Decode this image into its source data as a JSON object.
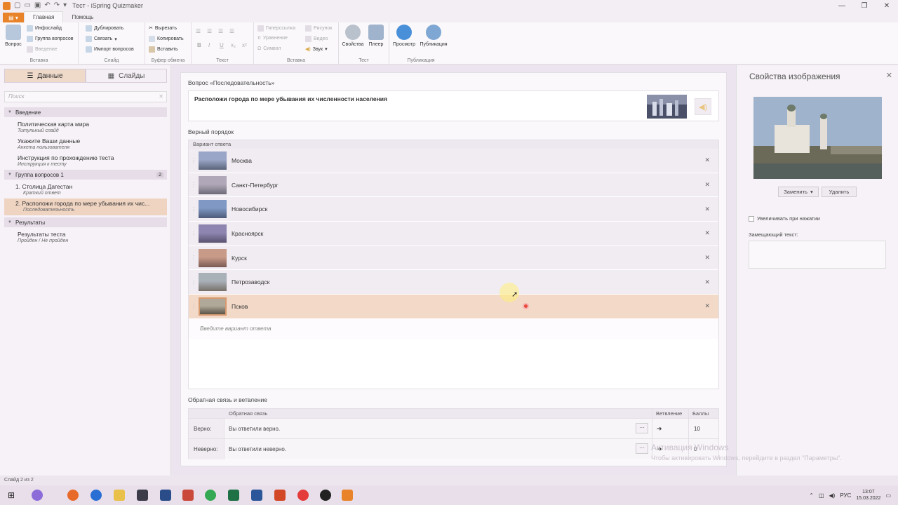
{
  "window": {
    "title": "Тест - iSpring Quizmaker"
  },
  "tabs": [
    "Главная",
    "Помощь"
  ],
  "ribbon": {
    "vopros": "Вопрос",
    "infoslide": "Инфослайд",
    "group_q": "Группа вопросов",
    "vvedenie": "Введение",
    "insert_label": "Вставка",
    "duplicate": "Дублировать",
    "link": "Связать",
    "import_q": "Импорт вопросов",
    "slide_label": "Слайд",
    "cut": "Вырезать",
    "copy": "Копировать",
    "paste": "Вставить",
    "clipboard_label": "Буфер обмена",
    "text_label": "Текст",
    "hyperlink": "Гиперссылка",
    "equation": "Уравнение",
    "symbol": "Символ",
    "picture": "Рисунок",
    "video": "Видео",
    "sound": "Звук",
    "insert2_label": "Вставка",
    "properties": "Свойства",
    "player": "Плеер",
    "test_label": "Тест",
    "preview": "Просмотр",
    "publish": "Публикация",
    "publish_label": "Публикация"
  },
  "left": {
    "tab_data": "Данные",
    "tab_slides": "Слайды",
    "search_placeholder": "Поиск",
    "sec_intro": "Введение",
    "i1_title": "Политическая карта мира",
    "i1_sub": "Титульный слайд",
    "i2_title": "Укажите Ваши данные",
    "i2_sub": "Анкета пользователя",
    "i3_title": "Инструкция по прохождению теста",
    "i3_sub": "Инструкция к тесту",
    "sec_group": "Группа вопросов 1",
    "sec_group_count": "2",
    "q1_title": "1.  Столица Дагестан",
    "q1_sub": "Краткий ответ",
    "q2_title": "2.  Расположи города по мере убывания их чис...",
    "q2_sub": "Последовательность",
    "sec_results": "Результаты",
    "r1_title": "Результаты теста",
    "r1_sub": "Пройден / Не пройден"
  },
  "main": {
    "question_label": "Вопрос «Последовательность»",
    "question_text": "Расположи города по мере убывания их численности населения",
    "order_label": "Верный порядок",
    "answer_col": "Вариант ответа",
    "answers": [
      "Москва",
      "Санкт-Петербург",
      "Новосибирск",
      "Красноярск",
      "Курск",
      "Петрозаводск",
      "Псков"
    ],
    "add_placeholder": "Введите вариант ответа",
    "feedback_label": "Обратная связь и ветвление",
    "fb_col": "Обратная связь",
    "branch_col": "Ветвление",
    "points_col": "Баллы",
    "fb_correct_label": "Верно:",
    "fb_correct_text": "Вы ответили верно.",
    "fb_correct_points": "10",
    "fb_wrong_label": "Неверно:",
    "fb_wrong_text": "Вы ответили неверно.",
    "fb_wrong_points": "0"
  },
  "right": {
    "title": "Свойства изображения",
    "replace": "Заменить",
    "delete": "Удалить",
    "enlarge": "Увеличивать при нажатии",
    "alt_label": "Замещающий текст:"
  },
  "status": {
    "slide": "Слайд 2 из 2"
  },
  "taskbar": {
    "lang": "РУС",
    "time": "13:07",
    "date": "15.03.2022"
  },
  "watermark": {
    "line1": "Активация Windows",
    "line2": "Чтобы активировать Windows, перейдите в раздел \"Параметры\"."
  },
  "colors": {
    "accent": "#e8832a",
    "selection": "#f2d9c8"
  }
}
